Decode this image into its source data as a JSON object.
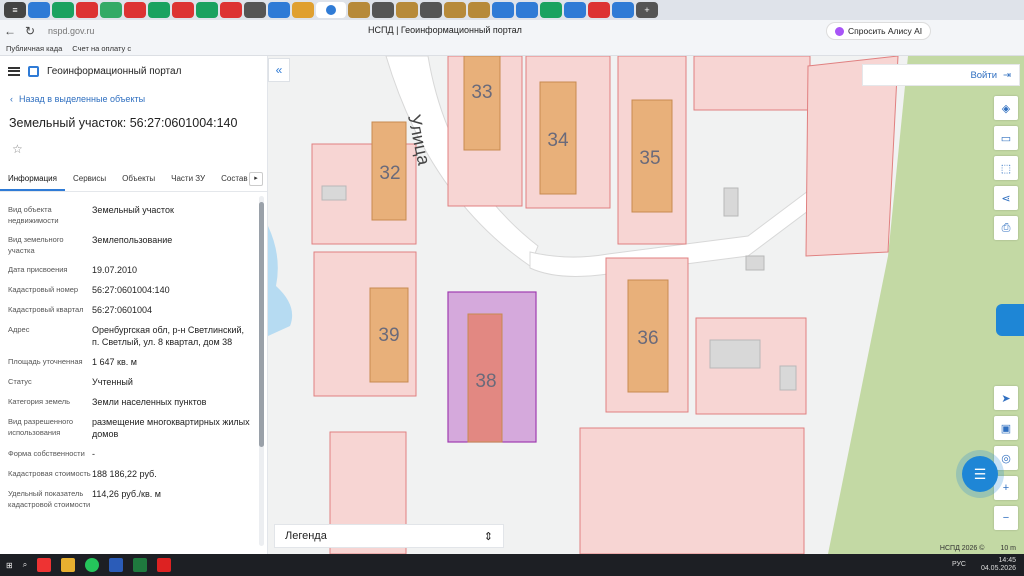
{
  "browser": {
    "url": "nspd.gov.ru",
    "page_title": "НСПД | Геоинформационный портал",
    "alice_label": "Спросить Алису AI",
    "bookmarks": [
      "Публичная када",
      "Счет на оплату с"
    ]
  },
  "app": {
    "title": "Геоинформационный портал",
    "back_label": "Назад в выделенные объекты",
    "parcel_title": "Земельный участок: 56:27:0601004:140",
    "tabs": [
      "Информация",
      "Сервисы",
      "Объекты",
      "Части ЗУ",
      "Состав"
    ],
    "properties": [
      {
        "key": "Вид объекта недвижимости",
        "value": "Земельный участок"
      },
      {
        "key": "Вид земельного участка",
        "value": "Землепользование"
      },
      {
        "key": "Дата присвоения",
        "value": "19.07.2010"
      },
      {
        "key": "Кадастровый номер",
        "value": "56:27:0601004:140"
      },
      {
        "key": "Кадастровый квартал",
        "value": "56:27:0601004"
      },
      {
        "key": "Адрес",
        "value": "Оренбургская обл, р-н Светлинский, п. Светлый, ул. 8 квартал, дом 38"
      },
      {
        "key": "Площадь уточненная",
        "value": "1 647 кв. м"
      },
      {
        "key": "Статус",
        "value": "Учтенный"
      },
      {
        "key": "Категория земель",
        "value": "Земли населенных пунктов"
      },
      {
        "key": "Вид разрешенного использования",
        "value": "размещение многоквартирных жилых домов"
      },
      {
        "key": "Форма собственности",
        "value": "-"
      },
      {
        "key": "Кадастровая стоимость",
        "value": "188 186,22 руб."
      },
      {
        "key": "Удельный показатель кадастровой стоимости",
        "value": "114,26 руб./кв. м"
      }
    ]
  },
  "map": {
    "login_label": "Войти",
    "legend_label": "Легенда",
    "street_label": "Улица",
    "building_numbers": [
      "33",
      "34",
      "35",
      "32",
      "39",
      "38",
      "36"
    ],
    "scale_label": "10 m",
    "copyright": "НСПД 2026 ©",
    "selected_fill": "#c98ad3",
    "parcel_fill": "#f7d5d3",
    "building_fill": "#e8b07a"
  },
  "taskbar": {
    "lang": "РУС",
    "time": "14:45",
    "date": "04.05.2026"
  }
}
